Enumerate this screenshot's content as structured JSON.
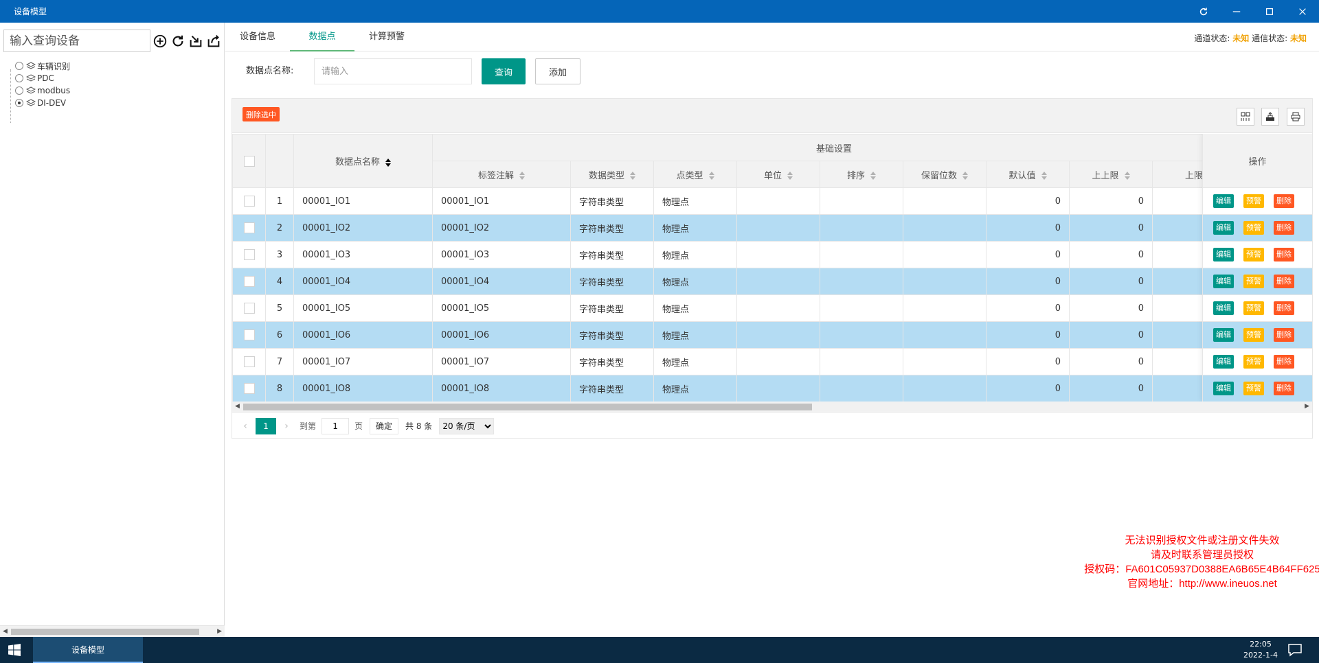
{
  "window": {
    "title": "设备模型"
  },
  "left": {
    "search_placeholder": "输入查询设备",
    "tree": [
      {
        "label": "车辆识别",
        "selected": false
      },
      {
        "label": "PDC",
        "selected": false
      },
      {
        "label": "modbus",
        "selected": false
      },
      {
        "label": "DI-DEV",
        "selected": true
      }
    ]
  },
  "tabs": [
    "设备信息",
    "数据点",
    "计算预警"
  ],
  "status": {
    "channel_label": "通道状态:",
    "channel_value": "未知",
    "comm_label": "通信状态:",
    "comm_value": "未知"
  },
  "query": {
    "label": "数据点名称:",
    "placeholder": "请输入",
    "query_btn": "查询",
    "add_btn": "添加"
  },
  "toolbar": {
    "delete_selected": "删除选中"
  },
  "table": {
    "col_name": "数据点名称",
    "group_header": "基础设置",
    "sub_headers": [
      "标签注解",
      "数据类型",
      "点类型",
      "单位",
      "排序",
      "保留位数",
      "默认值",
      "上上限",
      "上限"
    ],
    "op_header": "操作",
    "rows": [
      {
        "idx": "1",
        "name": "00001_IO1",
        "label": "00001_IO1",
        "dtype": "字符串类型",
        "ptype": "物理点",
        "default": "0",
        "hh": "0"
      },
      {
        "idx": "2",
        "name": "00001_IO2",
        "label": "00001_IO2",
        "dtype": "字符串类型",
        "ptype": "物理点",
        "default": "0",
        "hh": "0"
      },
      {
        "idx": "3",
        "name": "00001_IO3",
        "label": "00001_IO3",
        "dtype": "字符串类型",
        "ptype": "物理点",
        "default": "0",
        "hh": "0"
      },
      {
        "idx": "4",
        "name": "00001_IO4",
        "label": "00001_IO4",
        "dtype": "字符串类型",
        "ptype": "物理点",
        "default": "0",
        "hh": "0"
      },
      {
        "idx": "5",
        "name": "00001_IO5",
        "label": "00001_IO5",
        "dtype": "字符串类型",
        "ptype": "物理点",
        "default": "0",
        "hh": "0"
      },
      {
        "idx": "6",
        "name": "00001_IO6",
        "label": "00001_IO6",
        "dtype": "字符串类型",
        "ptype": "物理点",
        "default": "0",
        "hh": "0"
      },
      {
        "idx": "7",
        "name": "00001_IO7",
        "label": "00001_IO7",
        "dtype": "字符串类型",
        "ptype": "物理点",
        "default": "0",
        "hh": "0"
      },
      {
        "idx": "8",
        "name": "00001_IO8",
        "label": "00001_IO8",
        "dtype": "字符串类型",
        "ptype": "物理点",
        "default": "0",
        "hh": "0"
      }
    ],
    "op_edit": "编辑",
    "op_warn": "预警",
    "op_delete": "删除"
  },
  "pager": {
    "current": "1",
    "goto_label": "到第",
    "page_input": "1",
    "page_unit": "页",
    "confirm": "确定",
    "total": "共 8 条",
    "page_size": "20 条/页"
  },
  "license": {
    "line1": "无法识别授权文件或注册文件失效",
    "line2": "请及时联系管理员授权",
    "line3": "授权码：FA601C05937D0388EA6B65E4B64FF625",
    "line4": "官网地址：http://www.ineuos.net"
  },
  "taskbar": {
    "app": "设备模型",
    "time": "22:05",
    "date": "2022-1-4"
  },
  "colors": {
    "titlebar": "#0565b8",
    "primary": "#009688",
    "warn": "#ffb800",
    "danger": "#ff5722",
    "row_highlight": "#b4dcf3"
  },
  "icons": [
    "refresh-icon",
    "minimize-icon",
    "maximize-icon",
    "close-icon",
    "add-circle-icon",
    "reload-icon",
    "import-icon",
    "export-icon",
    "layers-icon",
    "columns-icon",
    "export-table-icon",
    "print-icon",
    "windows-start-icon",
    "notification-icon"
  ]
}
